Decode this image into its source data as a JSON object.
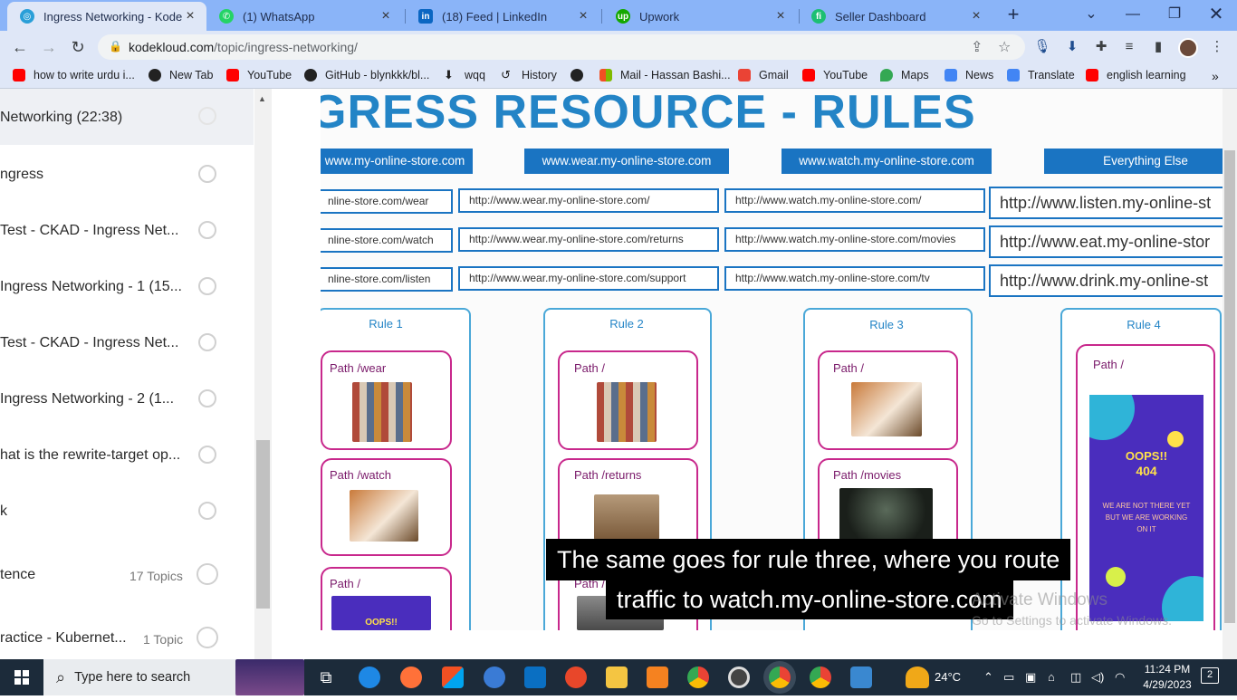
{
  "browser": {
    "tabs": [
      {
        "label": "Ingress Networking - KodeKl",
        "icon": "kodekloud-icon",
        "color": "#2a9fd8",
        "active": true
      },
      {
        "label": "(1) WhatsApp",
        "icon": "whatsapp-icon",
        "color": "#25d366",
        "active": false
      },
      {
        "label": "(18) Feed | LinkedIn",
        "icon": "linkedin-icon",
        "color": "#0a66c2",
        "active": false
      },
      {
        "label": "Upwork",
        "icon": "upwork-icon",
        "color": "#14a800",
        "active": false
      },
      {
        "label": "Seller Dashboard",
        "icon": "fiverr-icon",
        "color": "#1dbf73",
        "active": false
      }
    ],
    "url_host": "kodekloud.com",
    "url_path": "/topic/ingress-networking/",
    "bookmarks": [
      {
        "label": "how to write urdu i...",
        "icon": "youtube-icon",
        "color": "#ff0000"
      },
      {
        "label": "New Tab",
        "icon": "globe-icon",
        "color": "#222222"
      },
      {
        "label": "YouTube",
        "icon": "youtube-icon",
        "color": "#ff0000"
      },
      {
        "label": "GitHub - blynkkk/bl...",
        "icon": "github-icon",
        "color": "#222222"
      },
      {
        "label": "wqq",
        "icon": "download-icon",
        "color": "#222222"
      },
      {
        "label": "History",
        "icon": "history-icon",
        "color": "#222222"
      },
      {
        "label": "",
        "icon": "globe-icon",
        "color": "#222222"
      },
      {
        "label": "Mail - Hassan Bashi...",
        "icon": "microsoft-icon",
        "color": "#f25022"
      },
      {
        "label": "Gmail",
        "icon": "gmail-icon",
        "color": "#ea4335"
      },
      {
        "label": "YouTube",
        "icon": "youtube-icon",
        "color": "#ff0000"
      },
      {
        "label": "Maps",
        "icon": "maps-icon",
        "color": "#34a853"
      },
      {
        "label": "News",
        "icon": "news-icon",
        "color": "#4285f4"
      },
      {
        "label": "Translate",
        "icon": "translate-icon",
        "color": "#4285f4"
      },
      {
        "label": "english learning",
        "icon": "youtube-icon",
        "color": "#ff0000"
      }
    ]
  },
  "sidebar": {
    "items": [
      {
        "label": "Networking (22:38)",
        "count": ""
      },
      {
        "label": "ngress",
        "count": ""
      },
      {
        "label": "Test - CKAD - Ingress Net...",
        "count": ""
      },
      {
        "label": " Ingress Networking - 1 (15...",
        "count": ""
      },
      {
        "label": "Test - CKAD - Ingress Net...",
        "count": ""
      },
      {
        "label": " Ingress Networking - 2 (1...",
        "count": ""
      },
      {
        "label": "hat is the rewrite-target op...",
        "count": ""
      },
      {
        "label": "k",
        "count": ""
      },
      {
        "label": "tence",
        "count": "17 Topics"
      },
      {
        "label": "ractice - Kubernet...",
        "count": "1 Topic"
      }
    ]
  },
  "slide": {
    "title": "GRESS RESOURCE - RULES",
    "hosts": [
      "www.my-online-store.com",
      "www.wear.my-online-store.com",
      "www.watch.my-online-store.com",
      "Everything Else"
    ],
    "urls": [
      [
        "nline-store.com/wear",
        "nline-store.com/watch",
        "nline-store.com/listen"
      ],
      [
        "http://www.wear.my-online-store.com/",
        "http://www.wear.my-online-store.com/returns",
        "http://www.wear.my-online-store.com/support"
      ],
      [
        "http://www.watch.my-online-store.com/",
        "http://www.watch.my-online-store.com/movies",
        "http://www.watch.my-online-store.com/tv"
      ],
      [
        "http://www.listen.my-online-st",
        "http://www.eat.my-online-stor",
        "http://www.drink.my-online-st"
      ]
    ],
    "rules": [
      {
        "label": "Rule 1",
        "paths": [
          "Path /wear",
          "Path /watch",
          "Path /"
        ]
      },
      {
        "label": "Rule 2",
        "paths": [
          "Path /",
          "Path /returns",
          "Path /"
        ]
      },
      {
        "label": "Rule 3",
        "paths": [
          "Path /",
          "Path /movies"
        ]
      },
      {
        "label": "Rule 4",
        "paths": [
          "Path /"
        ]
      }
    ],
    "oops": {
      "big": "OOPS!!",
      "code": "404",
      "message": "WE ARE NOT THERE YET BUT WE ARE WORKING ON IT",
      "small": "OOPS!!"
    },
    "caption_line1": "The same goes for rule three, where you route",
    "caption_line2": "traffic to watch.my-online-store.com"
  },
  "watermark": {
    "line1": "Activate Windows",
    "line2": "Go to Settings to activate Windows."
  },
  "taskbar": {
    "search_placeholder": "Type here to search",
    "weather": "24°C",
    "time": "11:24 PM",
    "date": "4/29/2023",
    "notifications": "2"
  },
  "colors": {
    "accent": "#2384c6",
    "path_border": "#c8288c",
    "tabbar": "#8ab4f8"
  }
}
